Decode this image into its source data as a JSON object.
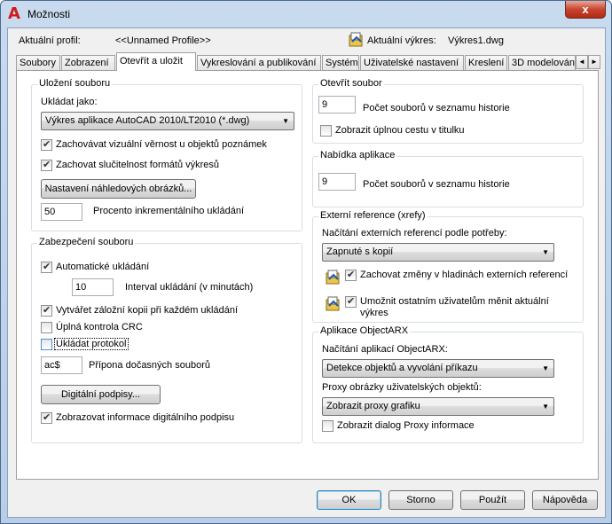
{
  "window": {
    "title": "Možnosti",
    "close_label": "x"
  },
  "profile": {
    "label": "Aktuální profil:",
    "value": "<<Unnamed Profile>>",
    "drawing_label": "Aktuální výkres:",
    "drawing_value": "Výkres1.dwg"
  },
  "tabs": [
    "Soubory",
    "Zobrazení",
    "Otevřít a uložit",
    "Vykreslování a publikování",
    "Systém",
    "Uživatelské nastavení",
    "Kreslení",
    "3D modelování"
  ],
  "tab_scroll": {
    "left": "◄",
    "right": "►"
  },
  "save": {
    "group_label": "Uložení souboru",
    "save_as_label": "Ukládat jako:",
    "save_as_value": "Výkres aplikace AutoCAD 2010/LT2010 (*.dwg)",
    "maintain_visual_fidelity": "Zachovávat vizuální věrnost u objektů poznámek",
    "maintain_format_compat": "Zachovat  slučitelnost formátů výkresů",
    "thumbnail_button": "Nastavení náhledových obrázků...",
    "incremental_value": "50",
    "incremental_label": "Procento inkrementálního ukládání"
  },
  "security": {
    "group_label": "Zabezpečení souboru",
    "autosave": "Automatické ukládání",
    "interval_value": "10",
    "interval_label": "Interval ukládání (v minutách)",
    "backup": "Vytvářet záložní kopii při každém ukládání",
    "crc": "Úplná kontrola CRC",
    "log": "Ukládat protokol",
    "temp_ext_value": "ac$",
    "temp_ext_label": "Přípona dočasných souborů",
    "digsig_button": "Digitální podpisy...",
    "show_digsig": "Zobrazovat informace digitálního podpisu"
  },
  "open": {
    "group_label": "Otevřít soubor",
    "history_value": "9",
    "history_label": "Počet souborů v seznamu historie",
    "full_path": "Zobrazit úplnou cestu v titulku"
  },
  "appmenu": {
    "group_label": "Nabídka aplikace",
    "history_value": "9",
    "history_label": "Počet souborů v seznamu historie"
  },
  "xref": {
    "group_label": "Externí reference (xrefy)",
    "demand_label": "Načítání externích referencí podle potřeby:",
    "demand_value": "Zapnuté s kopií",
    "retain_layers": "Zachovat změny v hladinách externích referencí",
    "allow_edit": "Umožnit ostatním uživatelům měnit aktuální výkres"
  },
  "arx": {
    "group_label": "Aplikace ObjectARX",
    "demand_label": "Načítání aplikací ObjectARX:",
    "demand_value": "Detekce objektů a vyvolání příkazu",
    "proxy_label": "Proxy obrázky uživatelských objektů:",
    "proxy_value": "Zobrazit proxy grafiku",
    "proxy_dialog": "Zobrazit dialog Proxy informace"
  },
  "footer": {
    "ok": "OK",
    "cancel": "Storno",
    "apply": "Použít",
    "help": "Nápověda"
  },
  "colors": {
    "accent": "#3c7fb1",
    "title_bg": "#c9daee",
    "close": "#c8452f"
  }
}
